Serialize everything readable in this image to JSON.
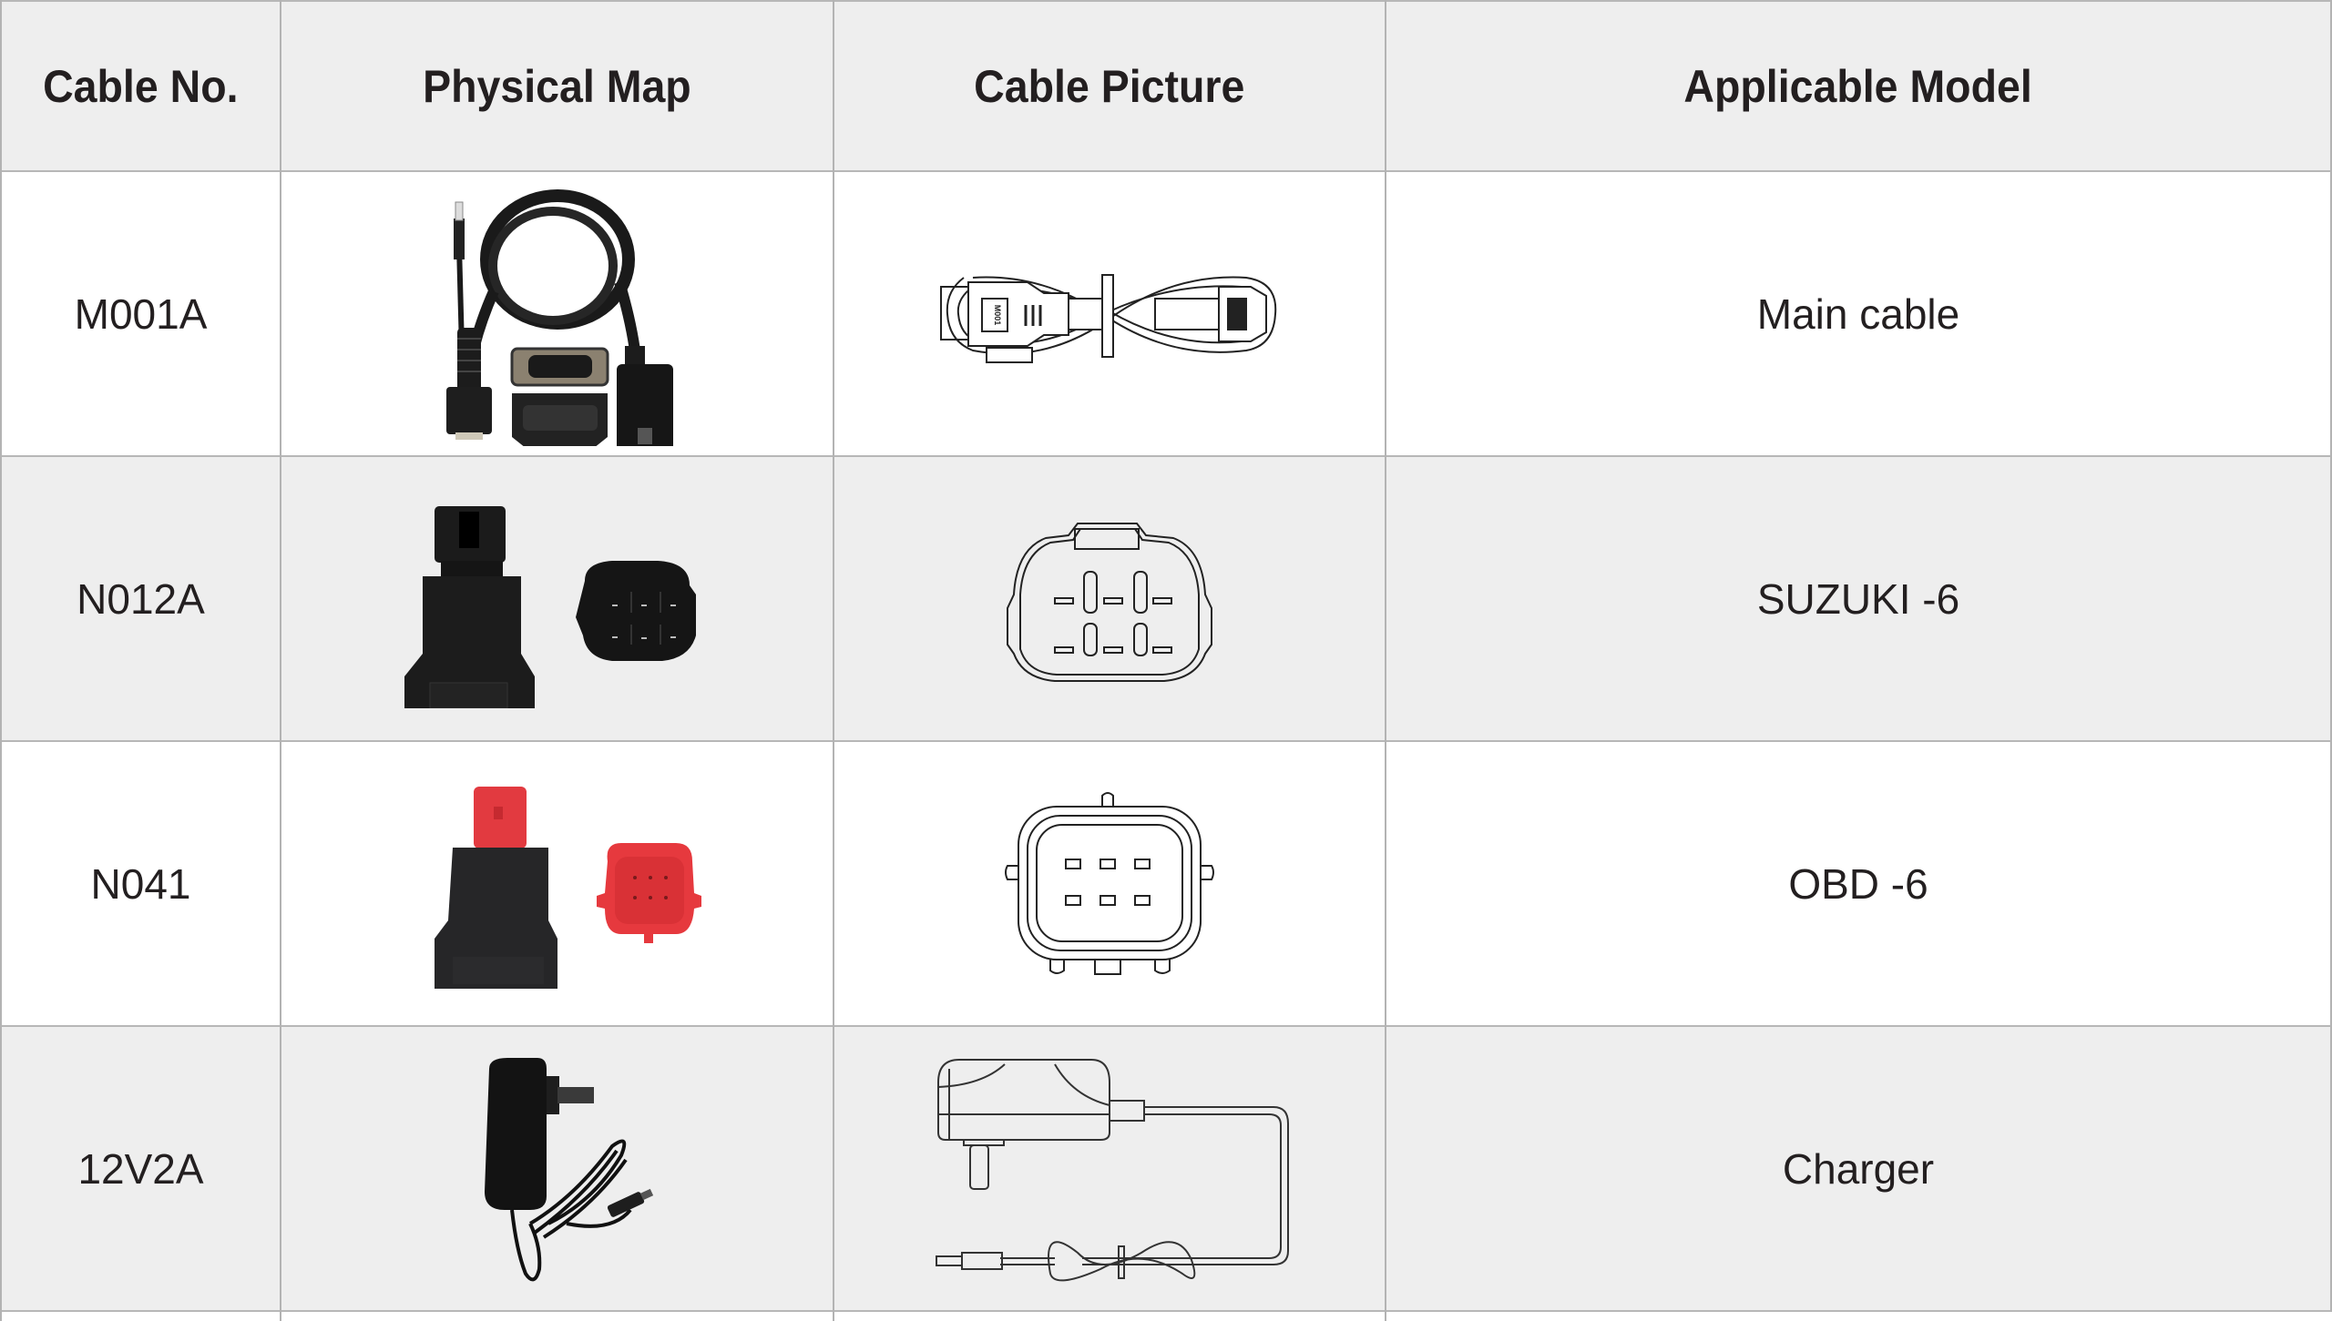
{
  "table": {
    "headers": [
      "Cable No.",
      "Physical Map",
      "Cable Picture",
      "Applicable Model"
    ],
    "rows": [
      {
        "cable_no": "M001A",
        "physical_map_icon": "main-cable-photo",
        "cable_picture_icon": "main-cable-drawing",
        "cable_picture_label": "M001",
        "applicable_model": "Main cable"
      },
      {
        "cable_no": "N012A",
        "physical_map_icon": "suzuki-6-adapter-photo",
        "cable_picture_icon": "suzuki-6-connector-drawing",
        "applicable_model": "SUZUKI -6"
      },
      {
        "cable_no": "N041",
        "physical_map_icon": "obd-6-adapter-photo",
        "cable_picture_icon": "obd-6-connector-drawing",
        "applicable_model": "OBD -6"
      },
      {
        "cable_no": "12V2A",
        "physical_map_icon": "charger-photo",
        "cable_picture_icon": "charger-drawing",
        "applicable_model": "Charger"
      }
    ]
  },
  "colors": {
    "header_bg": "#eeeeee",
    "alt_row_bg": "#eeeeee",
    "row_bg": "#ffffff",
    "grid_line": "#b3b3b3",
    "text": "#231f20",
    "adapter_red": "#e8383d"
  }
}
